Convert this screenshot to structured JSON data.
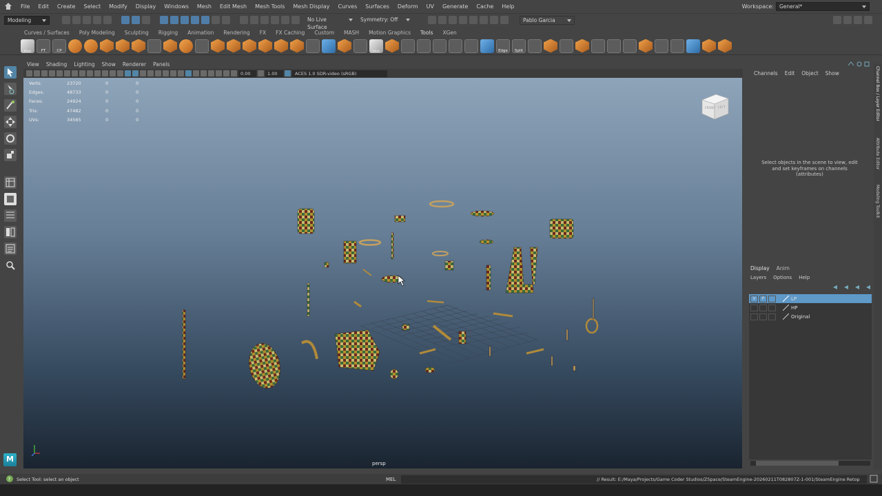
{
  "menubar": {
    "items": [
      "File",
      "Edit",
      "Create",
      "Select",
      "Modify",
      "Display",
      "Windows",
      "Mesh",
      "Edit Mesh",
      "Mesh Tools",
      "Mesh Display",
      "Curves",
      "Surfaces",
      "Deform",
      "UV",
      "Generate",
      "Cache",
      "Help"
    ],
    "workspace_label": "Workspace:",
    "workspace_value": "General*"
  },
  "statusline": {
    "mode": "Modeling",
    "live_surface": "No Live Surface",
    "symmetry": "Symmetry: Off",
    "user": "Pablo Garcia"
  },
  "shelf": {
    "tabs": [
      "Curves / Surfaces",
      "Poly Modeling",
      "Sculpting",
      "Rigging",
      "Animation",
      "Rendering",
      "FX",
      "FX Caching",
      "Custom",
      "MASH",
      "Motion Graphics",
      "Tools",
      "XGen"
    ],
    "active_tab": "Tools",
    "labels": {
      "hist": "Hist",
      "ft": "FT",
      "cp": "CP",
      "hist2": "Hist",
      "edge": "Edge",
      "split": "Split"
    }
  },
  "panel": {
    "menus": [
      "View",
      "Shading",
      "Lighting",
      "Show",
      "Renderer",
      "Panels"
    ],
    "near": "0.00",
    "far": "1.00",
    "colorspace": "ACES 1.0 SDR-video (sRGB)"
  },
  "hud": {
    "rows": [
      {
        "k": "Verts:",
        "v": "23720",
        "a": "0",
        "b": "0"
      },
      {
        "k": "Edges:",
        "v": "48733",
        "a": "0",
        "b": "0"
      },
      {
        "k": "Faces:",
        "v": "24924",
        "a": "0",
        "b": "0"
      },
      {
        "k": "Tris:",
        "v": "47482",
        "a": "0",
        "b": "0"
      },
      {
        "k": "UVs:",
        "v": "34565",
        "a": "0",
        "b": "0"
      }
    ]
  },
  "viewport": {
    "camera": "persp",
    "cube_front": "FRONT",
    "cube_left": "LEFT"
  },
  "channelbox": {
    "tabs": [
      "Channels",
      "Edit",
      "Object",
      "Show"
    ],
    "hint": "Select objects in the scene to view, edit and set keyframes on channels (attributes)"
  },
  "side_tabs": [
    "Channel Box / Layer Editor",
    "Attribute Editor",
    "Modeling Toolkit"
  ],
  "layers": {
    "tabs": [
      "Display",
      "Anim"
    ],
    "active_tab": "Display",
    "menus": [
      "Layers",
      "Options",
      "Help"
    ],
    "rows": [
      {
        "v": "V",
        "p": "P",
        "name": "LP",
        "selected": true
      },
      {
        "v": "",
        "p": "",
        "name": "HP",
        "selected": false
      },
      {
        "v": "",
        "p": "",
        "name": "Original",
        "selected": false
      }
    ]
  },
  "commandline": {
    "help": "Select Tool: select an object",
    "lang": "MEL",
    "result": "// Result: E:/Maya/Projects/Game Coder Studios/ZSpace/SteamEngine-20260211T082807Z-1-001/SteamEngine Retop"
  },
  "colors": {
    "accent": "#5285a6",
    "selection": "#5e99c8",
    "bg": "#444444"
  }
}
